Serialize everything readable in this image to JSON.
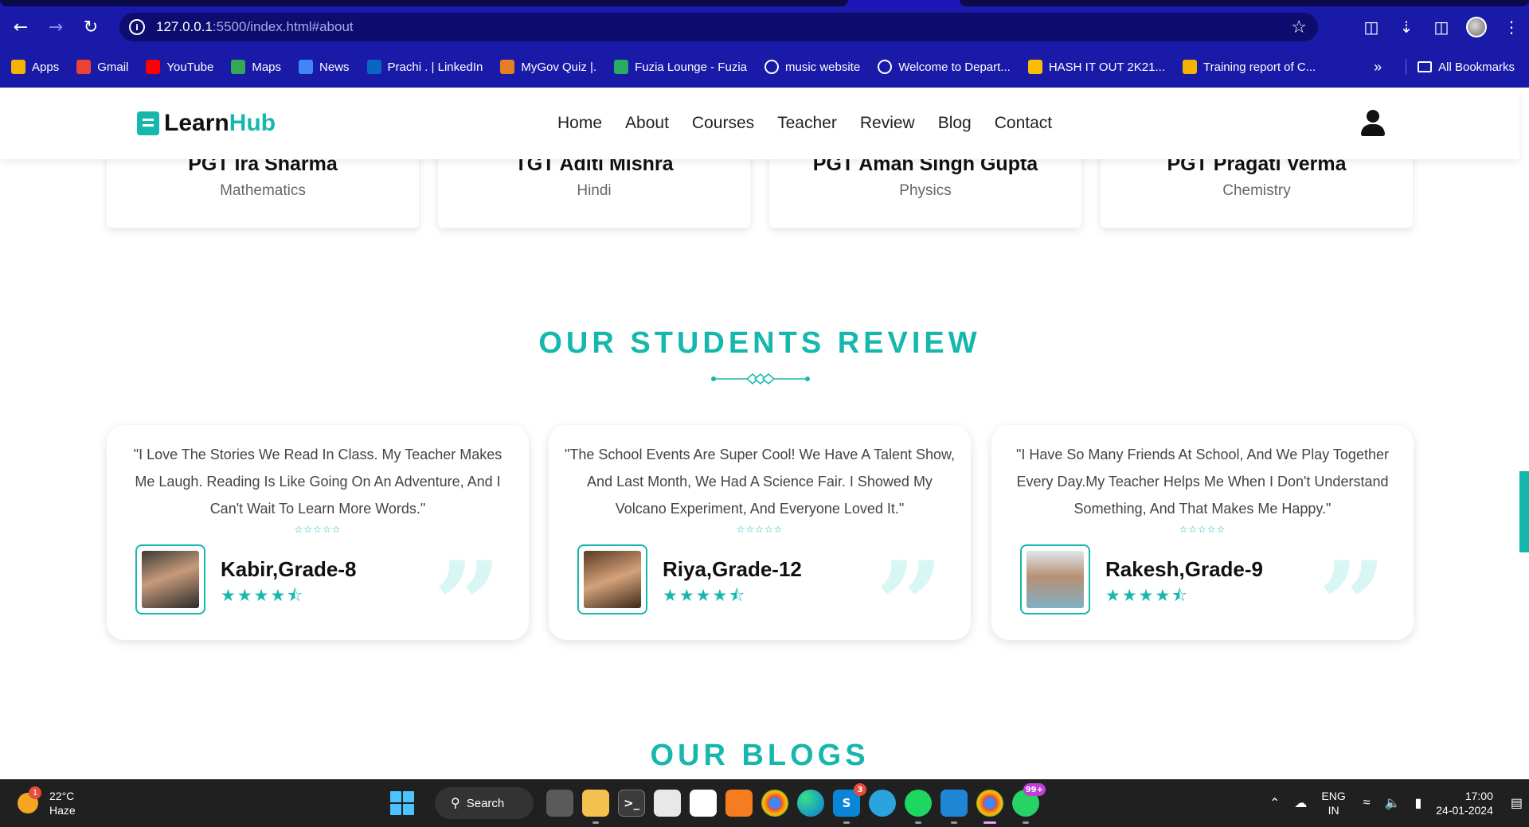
{
  "browser": {
    "url_host": "127.0.0.1",
    "url_rest": ":5500/index.html#about",
    "bookmarks": [
      {
        "label": "Apps",
        "icon": "apps-grid-icon",
        "color": "#f4b400"
      },
      {
        "label": "Gmail",
        "icon": "gmail-icon",
        "color": "#ea4335"
      },
      {
        "label": "YouTube",
        "icon": "youtube-icon",
        "color": "#ff0000"
      },
      {
        "label": "Maps",
        "icon": "maps-pin-icon",
        "color": "#34a853"
      },
      {
        "label": "News",
        "icon": "news-icon",
        "color": "#4285f4"
      },
      {
        "label": "Prachi . | LinkedIn",
        "icon": "linkedin-icon",
        "color": "#0a66c2"
      },
      {
        "label": "MyGov Quiz |.",
        "icon": "mygov-icon",
        "color": "#e67e22"
      },
      {
        "label": "Fuzia Lounge - Fuzia",
        "icon": "fuzia-icon",
        "color": "#27ae60"
      },
      {
        "label": "music website",
        "icon": "globe-icon",
        "color": "#ffffff"
      },
      {
        "label": "Welcome to Depart...",
        "icon": "globe-icon",
        "color": "#ffffff"
      },
      {
        "label": "HASH IT OUT 2K21...",
        "icon": "drive-icon",
        "color": "#fbbc04"
      },
      {
        "label": "Training report of C...",
        "icon": "forms-icon",
        "color": "#f4b400"
      }
    ],
    "all_bookmarks": "All Bookmarks",
    "more_label": "»"
  },
  "site": {
    "logo_learn": "Learn",
    "logo_hub": "Hub",
    "nav": [
      "Home",
      "About",
      "Courses",
      "Teacher",
      "Review",
      "Blog",
      "Contact"
    ],
    "accent": "#16b7ad"
  },
  "teachers": [
    {
      "name": "PGT Ira Sharma",
      "subject": "Mathematics"
    },
    {
      "name": "TGT Aditi Mishra",
      "subject": "Hindi"
    },
    {
      "name": "PGT Aman Singh Gupta",
      "subject": "Physics"
    },
    {
      "name": "PGT Pragati Verma",
      "subject": "Chemistry"
    }
  ],
  "reviews_section": {
    "title": "OUR STUDENTS REVIEW",
    "reviews": [
      {
        "text": "\"I Love The Stories We Read In Class. My Teacher Makes Me Laugh. Reading Is Like Going On An Adventure, And I Can't Wait To Learn More Words.\"",
        "name": "Kabir,Grade-8",
        "rating": 4.5,
        "avatar": "student-photo-male"
      },
      {
        "text": "\"The School Events Are Super Cool! We Have A Talent Show, And Last Month, We Had A Science Fair. I Showed My Volcano Experiment, And Everyone Loved It.\"",
        "name": "Riya,Grade-12",
        "rating": 4.5,
        "avatar": "student-photo-female"
      },
      {
        "text": "\"I Have So Many Friends At School, And We Play Together Every Day.My Teacher Helps Me When I Don't Understand Something, And That Makes Me Happy.\"",
        "name": "Rakesh,Grade-9",
        "rating": 4.5,
        "avatar": "student-photo-male-sunglasses"
      }
    ]
  },
  "blogs_section": {
    "title": "OUR BLOGS"
  },
  "taskbar": {
    "weather_temp": "22°C",
    "weather_desc": "Haze",
    "weather_badge": "1",
    "search_label": "Search",
    "skype_badge": "3",
    "whatsapp_badge": "99+",
    "lang_top": "ENG",
    "lang_bottom": "IN",
    "time": "17:00",
    "date": "24-01-2024"
  }
}
